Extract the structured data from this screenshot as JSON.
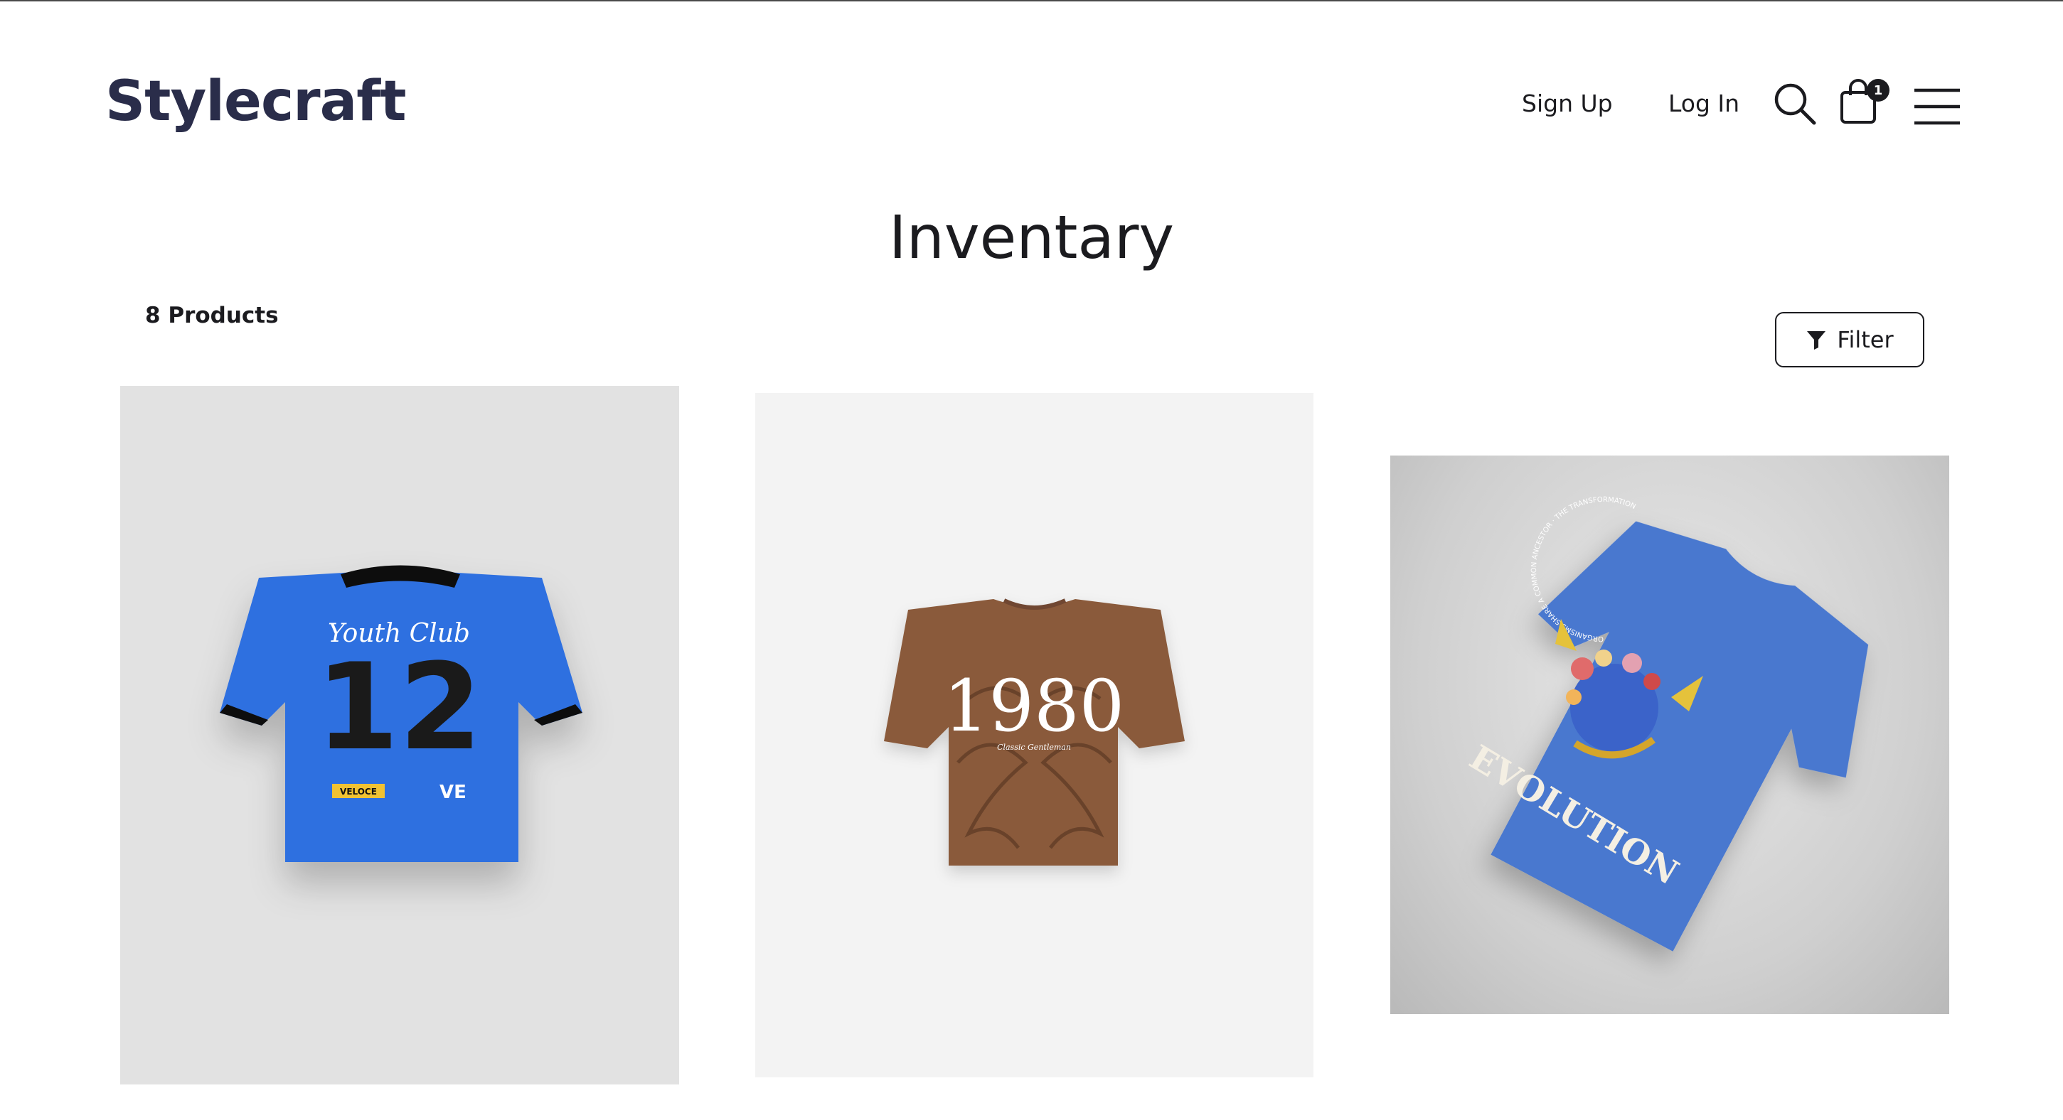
{
  "header": {
    "logo_text": "Stylecraft",
    "nav": {
      "signup_label": "Sign Up",
      "login_label": "Log In"
    },
    "cart_count": "1",
    "icons": [
      "search-icon",
      "shopping-bag-icon",
      "hamburger-menu-icon"
    ]
  },
  "main": {
    "title": "Inventary",
    "product_count": "8 Products",
    "filter_label": "Filter",
    "products": [
      {
        "shirt_color": "#2f6fe0",
        "print": {
          "script": "Youth Club",
          "number": "12",
          "tag": "VELOCE",
          "mark": "VE"
        }
      },
      {
        "shirt_color": "#8a5a3a",
        "print": {
          "number": "1980",
          "caption": "Classic Gentleman"
        }
      },
      {
        "shirt_color": "#4a78cf",
        "print": {
          "word": "EVOLUTION",
          "ring_text": "ORGANISMS SHARE A COMMON ANCESTOR · THE TRANSFORMATION"
        }
      }
    ]
  },
  "colors": {
    "text": "#1b1b1f",
    "logo": "#2a2d4a",
    "logo_accent": "#8a8fa0"
  }
}
